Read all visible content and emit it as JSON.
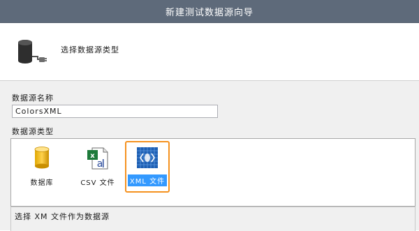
{
  "window": {
    "title": "新建测试数据源向导"
  },
  "header": {
    "title": "选择数据源类型",
    "icon": "database-connection-icon"
  },
  "form": {
    "name_label": "数据源名称",
    "name_value": "ColorsXML",
    "type_label": "数据源类型"
  },
  "types": [
    {
      "label": "数据库",
      "icon": "database-icon",
      "selected": false
    },
    {
      "label": "CSV 文件",
      "icon": "csv-file-icon",
      "selected": false
    },
    {
      "label": "XML 文件",
      "icon": "xml-file-icon",
      "selected": true
    }
  ],
  "description": "选择 XM 文件作为数据源",
  "colors": {
    "titlebar": "#5e6a7a",
    "selection": "#3399ff",
    "highlight_border": "#f5911e"
  }
}
